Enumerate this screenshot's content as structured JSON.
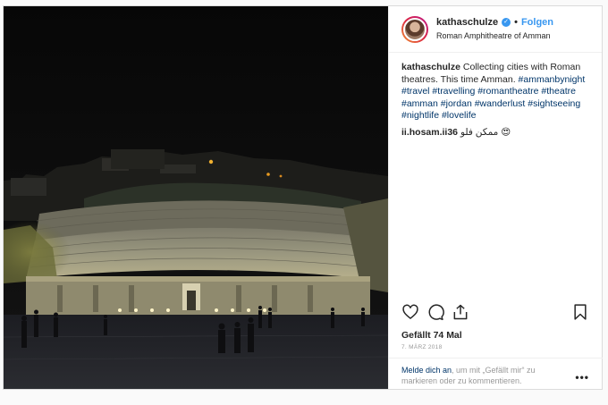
{
  "header": {
    "username": "kathaschulze",
    "dot": "•",
    "follow_label": "Folgen",
    "location": "Roman Amphitheatre of Amman"
  },
  "caption": {
    "username": "kathaschulze",
    "text": "Collecting cities with Roman theatres. This time Amman.",
    "hashtags": "#ammanbynight #travel #travelling #romantheatre #theatre #amman #jordan #wanderlust #sightseeing #nightlife #lovelife"
  },
  "comment": {
    "username": "ii.hosam.ii36",
    "text": "ممكن فلو 😍"
  },
  "icons": [
    "heart-icon",
    "comment-icon",
    "share-icon",
    "bookmark-icon",
    "verified-icon",
    "more-icon"
  ],
  "likes": "Gefällt 74 Mal",
  "date": "7. MÄRZ 2018",
  "login_prompt": {
    "link": "Melde dich an",
    "text": ", um mit „Gefällt mir“ zu markieren oder zu kommentieren."
  },
  "more_label": "•••",
  "colors": {
    "link": "#3897f0",
    "hashtag": "#003569",
    "muted": "#999999"
  }
}
